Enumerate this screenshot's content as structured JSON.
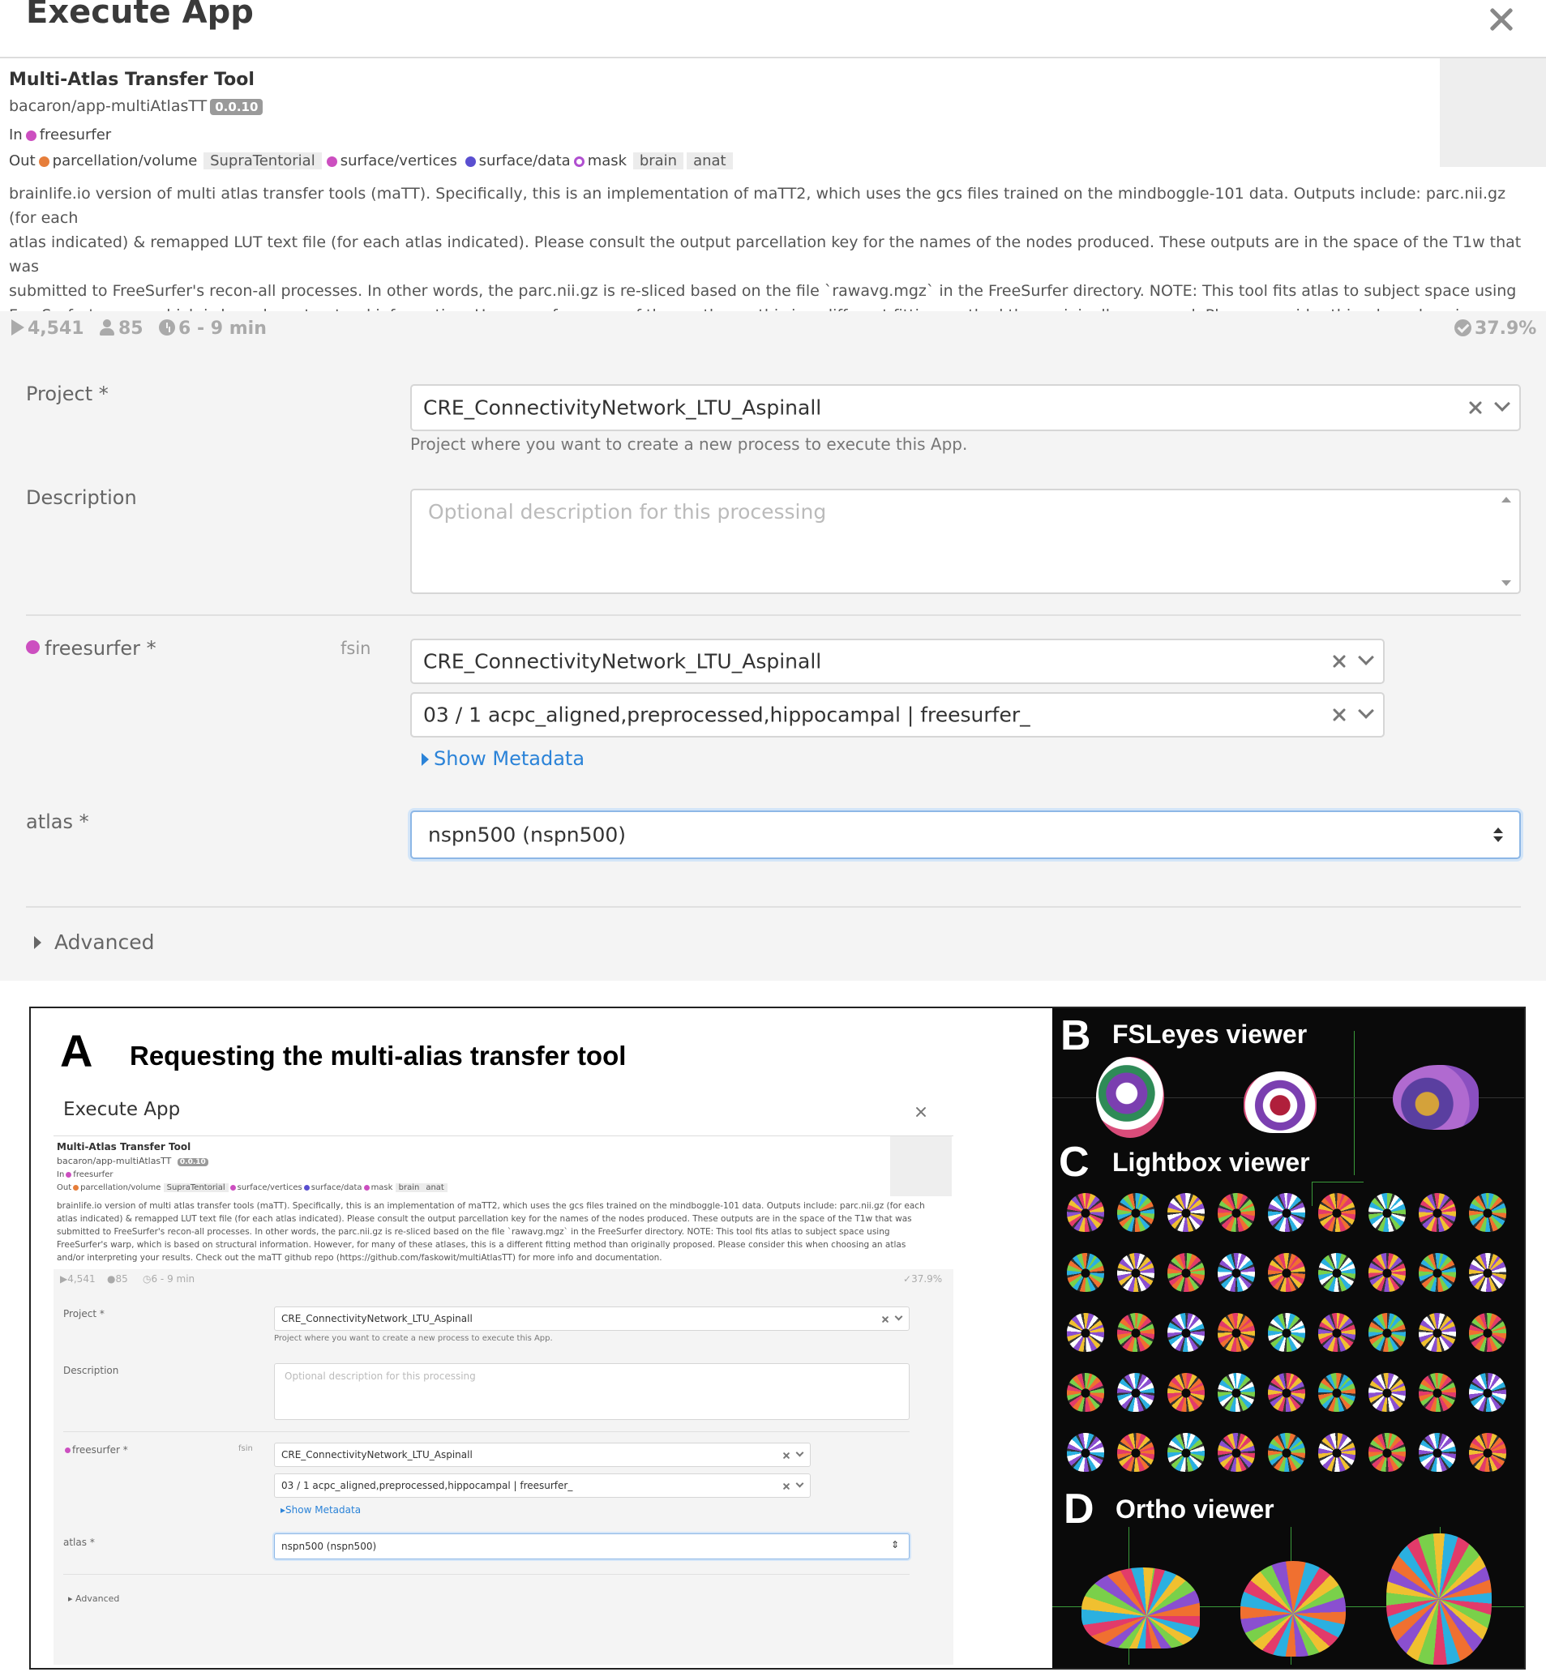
{
  "modal": {
    "title": "Execute App",
    "app": {
      "name": "Multi-Atlas Transfer Tool",
      "repo": "bacaron/app-multiAtlasTT",
      "version": "0.0.10",
      "in_label": "In",
      "inputs": [
        {
          "name": "freesurfer",
          "color": "#cc4fc0"
        }
      ],
      "out_label": "Out",
      "outputs": [
        {
          "name": "parcellation/volume",
          "color": "#e67e3b",
          "tags": [
            "SupraTentorial"
          ]
        },
        {
          "name": "surface/vertices",
          "color": "#cc4fc0",
          "tags": []
        },
        {
          "name": "surface/data",
          "color": "#5a4fd0",
          "tags": []
        },
        {
          "name": "mask",
          "color": "#b04fd0",
          "tags": [
            "brain",
            "anat"
          ]
        }
      ],
      "description_lines": [
        "brainlife.io version of multi atlas transfer tools (maTT). Specifically, this is an implementation of maTT2, which uses the gcs files trained on the mindboggle-101 data. Outputs include: parc.nii.gz (for each",
        "atlas indicated) & remapped LUT text file (for each atlas indicated). Please consult the output parcellation key for the names of the nodes produced. These outputs are in the space of the T1w that was",
        "submitted to FreeSurfer's recon-all processes. In other words, the parc.nii.gz is re-sliced based on the file `rawavg.mgz` in the FreeSurfer directory. NOTE: This tool fits atlas to subject space using",
        "FreeSurfer's warp, which is based on structural information. However, for many of these atlases, this is a different fitting method than originally proposed. Please consider this when choosing an atlas",
        "and/or interpreting your results. Check out the maTT github repo (https://github.com/faskowit/multiAtlasTT) for more info and documentation."
      ]
    },
    "stats": {
      "runs": "4,541",
      "users": "85",
      "duration": "6 - 9 min",
      "success": "37.9%"
    },
    "form": {
      "project_label": "Project *",
      "project_value": "CRE_ConnectivityNetwork_LTU_Aspinall",
      "project_help": "Project where you want to create a new process to execute this App.",
      "description_label": "Description",
      "description_placeholder": "Optional description for this processing",
      "freesurfer_label": "freesurfer *",
      "freesurfer_sub": "fsin",
      "freesurfer_project": "CRE_ConnectivityNetwork_LTU_Aspinall",
      "freesurfer_dataset": "03 / 1 acpc_aligned,preprocessed,hippocampal | freesurfer_",
      "show_metadata": "Show Metadata",
      "atlas_label": "atlas *",
      "atlas_value": "nspn500 (nspn500)",
      "advanced": "Advanced"
    }
  },
  "figure": {
    "panel_a": {
      "letter": "A",
      "title": "Requesting the multi-alias transfer tool"
    },
    "panel_b": {
      "letter": "B",
      "title": "FSLeyes viewer"
    },
    "panel_c": {
      "letter": "C",
      "title": "Lightbox viewer"
    },
    "panel_d": {
      "letter": "D",
      "title": "Ortho viewer"
    }
  }
}
